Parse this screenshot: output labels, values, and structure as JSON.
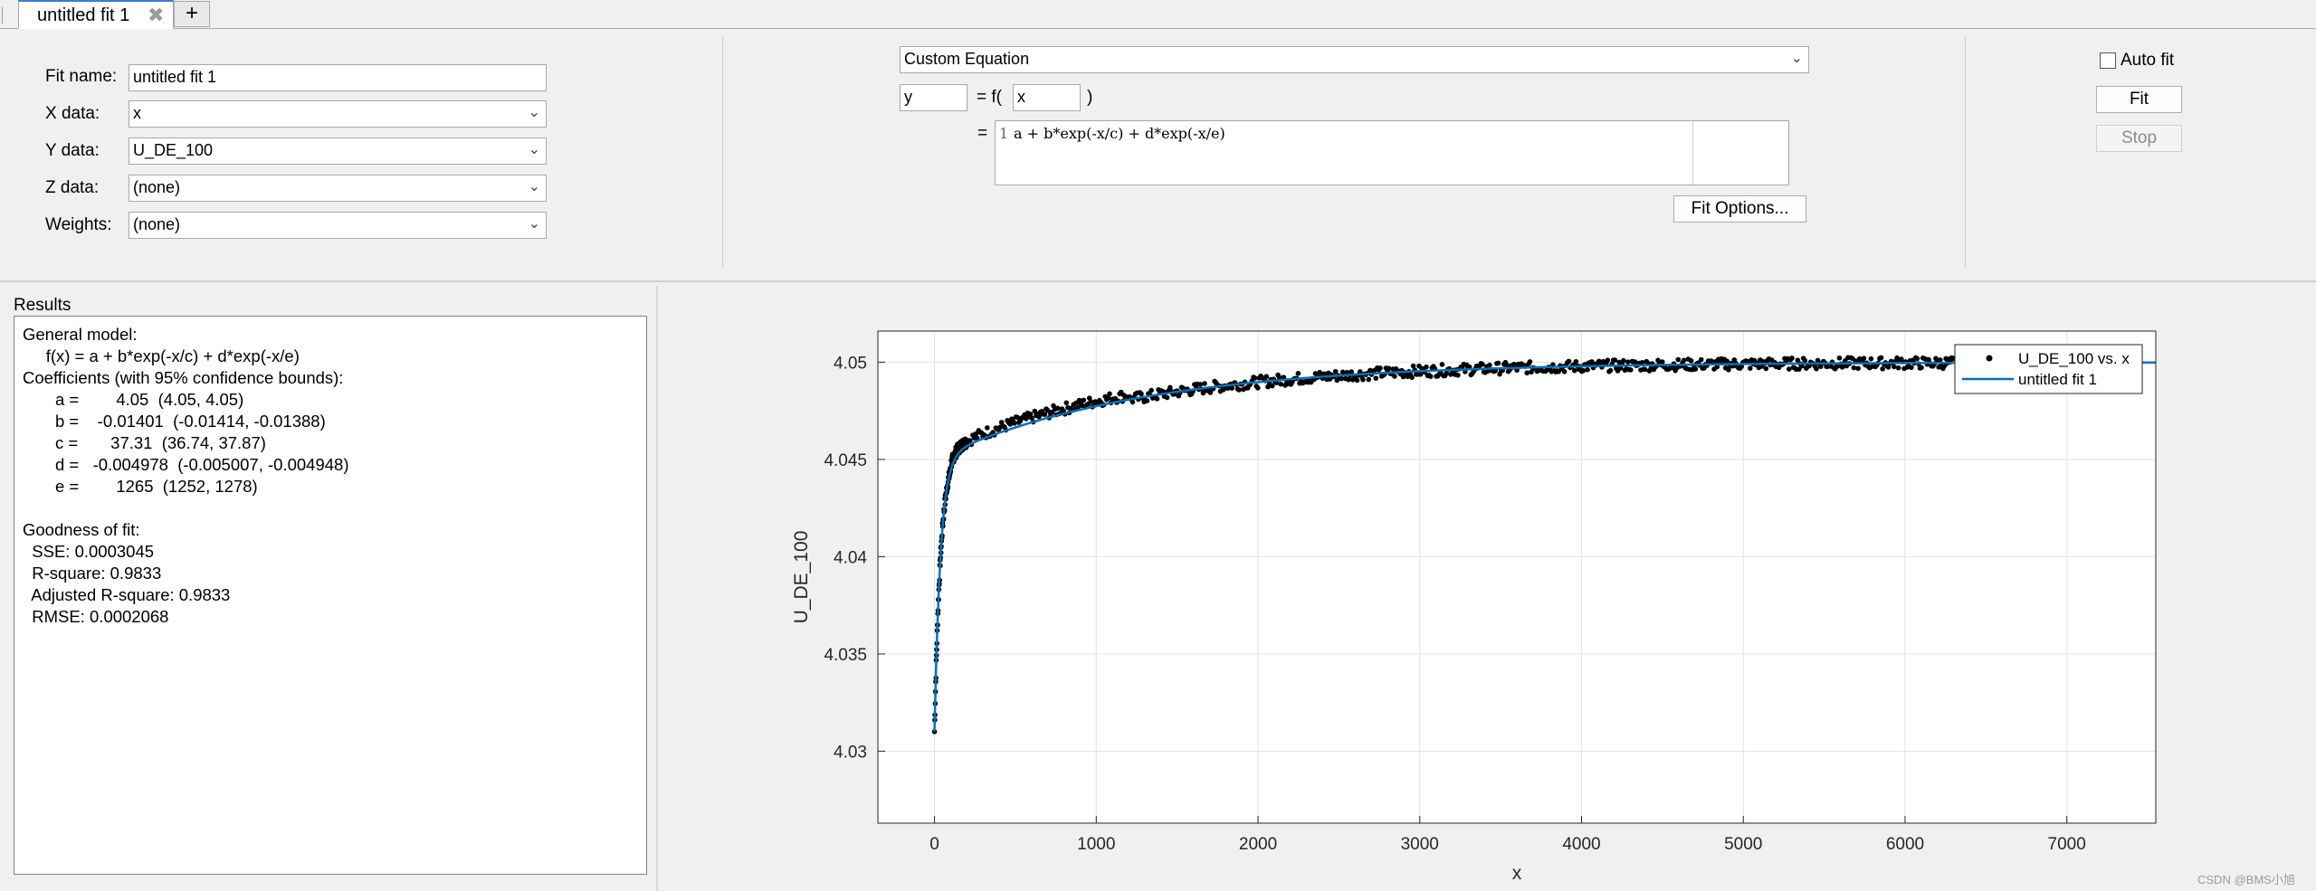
{
  "tabs": [
    {
      "label": "untitled fit 1",
      "close_icon": "close-icon"
    }
  ],
  "add_tab_label": "+",
  "fit_config": {
    "fit_name_label": "Fit name:",
    "fit_name_value": "untitled fit 1",
    "x_data_label": "X data:",
    "x_data_value": "x",
    "y_data_label": "Y data:",
    "y_data_value": "U_DE_100",
    "z_data_label": "Z data:",
    "z_data_value": "(none)",
    "weights_label": "Weights:",
    "weights_value": "(none)"
  },
  "equation": {
    "type_value": "Custom Equation",
    "dependent_var": "y",
    "equals_f": "= f(",
    "independent_var": "x",
    "close_paren": ")",
    "equals": "=",
    "line_number": "1",
    "expression": "a + b*exp(-x/c) + d*exp(-x/e)",
    "fit_options_label": "Fit Options..."
  },
  "controls": {
    "auto_fit_label": "Auto fit",
    "auto_fit_checked": false,
    "fit_label": "Fit",
    "stop_label": "Stop"
  },
  "results": {
    "title": "Results",
    "lines": [
      "General model:",
      "     f(x) = a + b*exp(-x/c) + d*exp(-x/e)",
      "Coefficients (with 95% confidence bounds):",
      "       a =        4.05  (4.05, 4.05)",
      "       b =    -0.01401  (-0.01414, -0.01388)",
      "       c =       37.31  (36.74, 37.87)",
      "       d =   -0.004978  (-0.005007, -0.004948)",
      "       e =        1265  (1252, 1278)",
      "",
      "Goodness of fit:",
      "  SSE: 0.0003045",
      "  R-square: 0.9833",
      "  Adjusted R-square: 0.9833",
      "  RMSE: 0.0002068"
    ]
  },
  "chart_data": {
    "type": "scatter",
    "xlabel": "x",
    "ylabel": "U_DE_100",
    "xlim": [
      -350,
      7550
    ],
    "ylim": [
      4.0263,
      4.0516
    ],
    "xticks": [
      0,
      1000,
      2000,
      3000,
      4000,
      5000,
      6000,
      7000
    ],
    "yticks": [
      4.03,
      4.035,
      4.04,
      4.045,
      4.05
    ],
    "ytick_labels": [
      "4.03",
      "4.035",
      "4.04",
      "4.045",
      "4.05"
    ],
    "grid": true,
    "legend_position": "top-right",
    "series": [
      {
        "name": "U_DE_100 vs. x",
        "style": "points",
        "color": "#000000"
      },
      {
        "name": "untitled fit 1",
        "style": "line",
        "color": "#0072bd",
        "model": {
          "a": 4.05,
          "b": -0.01401,
          "c": 37.31,
          "d": -0.004978,
          "e": 1265
        }
      }
    ]
  },
  "watermark": "CSDN @BMS小旭",
  "colors": {
    "fit_line": "#0072bd",
    "tab_accent": "#3a7bd5"
  }
}
